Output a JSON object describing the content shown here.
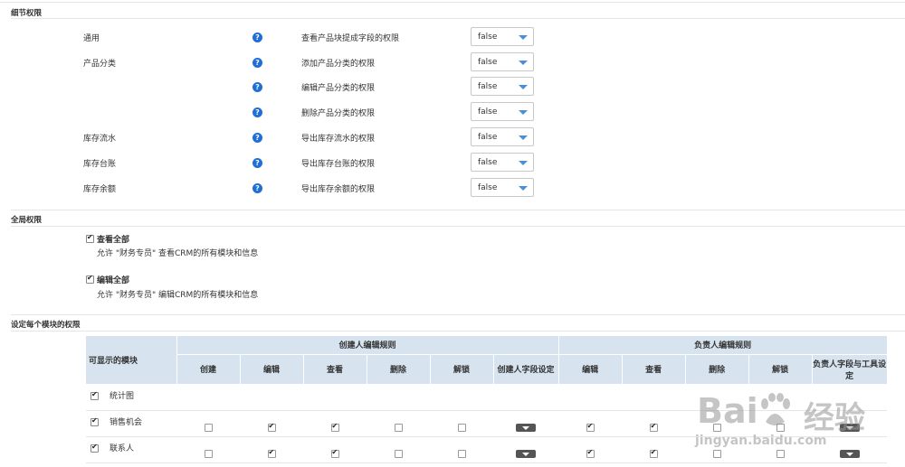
{
  "detail": {
    "title": "细节权限",
    "rows": [
      {
        "category": "通用",
        "permission": "查看产品块提成字段的权限",
        "value": "false"
      },
      {
        "category": "产品分类",
        "permission": "添加产品分类的权限",
        "value": "false"
      },
      {
        "category": "",
        "permission": "编辑产品分类的权限",
        "value": "false"
      },
      {
        "category": "",
        "permission": "删除产品分类的权限",
        "value": "false"
      },
      {
        "category": "库存流水",
        "permission": "导出库存流水的权限",
        "value": "false"
      },
      {
        "category": "库存台账",
        "permission": "导出库存台账的权限",
        "value": "false"
      },
      {
        "category": "库存余额",
        "permission": "导出库存余额的权限",
        "value": "false"
      }
    ],
    "help_glyph": "?"
  },
  "global": {
    "title": "全局权限",
    "view_all": {
      "label": "查看全部",
      "desc": "允许 \"财务专员\" 查看CRM的所有模块和信息",
      "checked": true
    },
    "edit_all": {
      "label": "编辑全部",
      "desc": "允许 \"财务专员\" 编辑CRM的所有模块和信息",
      "checked": true
    }
  },
  "modules": {
    "title": "设定每个模块的权限",
    "header": {
      "module": "可显示的模块",
      "creator_group": "创建人编辑规则",
      "owner_group": "负责人编辑规则",
      "creator_cols": [
        "创建",
        "编辑",
        "查看",
        "删除",
        "解锁",
        "创建人字段设定"
      ],
      "owner_cols": [
        "编辑",
        "查看",
        "删除",
        "解锁",
        "负责人字段与工具设定"
      ]
    },
    "rows": [
      {
        "name": "统计图",
        "enabled": true,
        "show_controls": false,
        "checks": []
      },
      {
        "name": "销售机会",
        "enabled": true,
        "show_controls": true,
        "checks": [
          false,
          true,
          true,
          false,
          false,
          true,
          true,
          false,
          false
        ]
      },
      {
        "name": "联系人",
        "enabled": true,
        "show_controls": true,
        "checks": [
          false,
          true,
          true,
          false,
          false,
          true,
          true,
          false,
          false
        ]
      }
    ]
  },
  "watermark": {
    "brand": "Bai",
    "brand2": "经验",
    "url": "jingyan.baidu.com"
  }
}
